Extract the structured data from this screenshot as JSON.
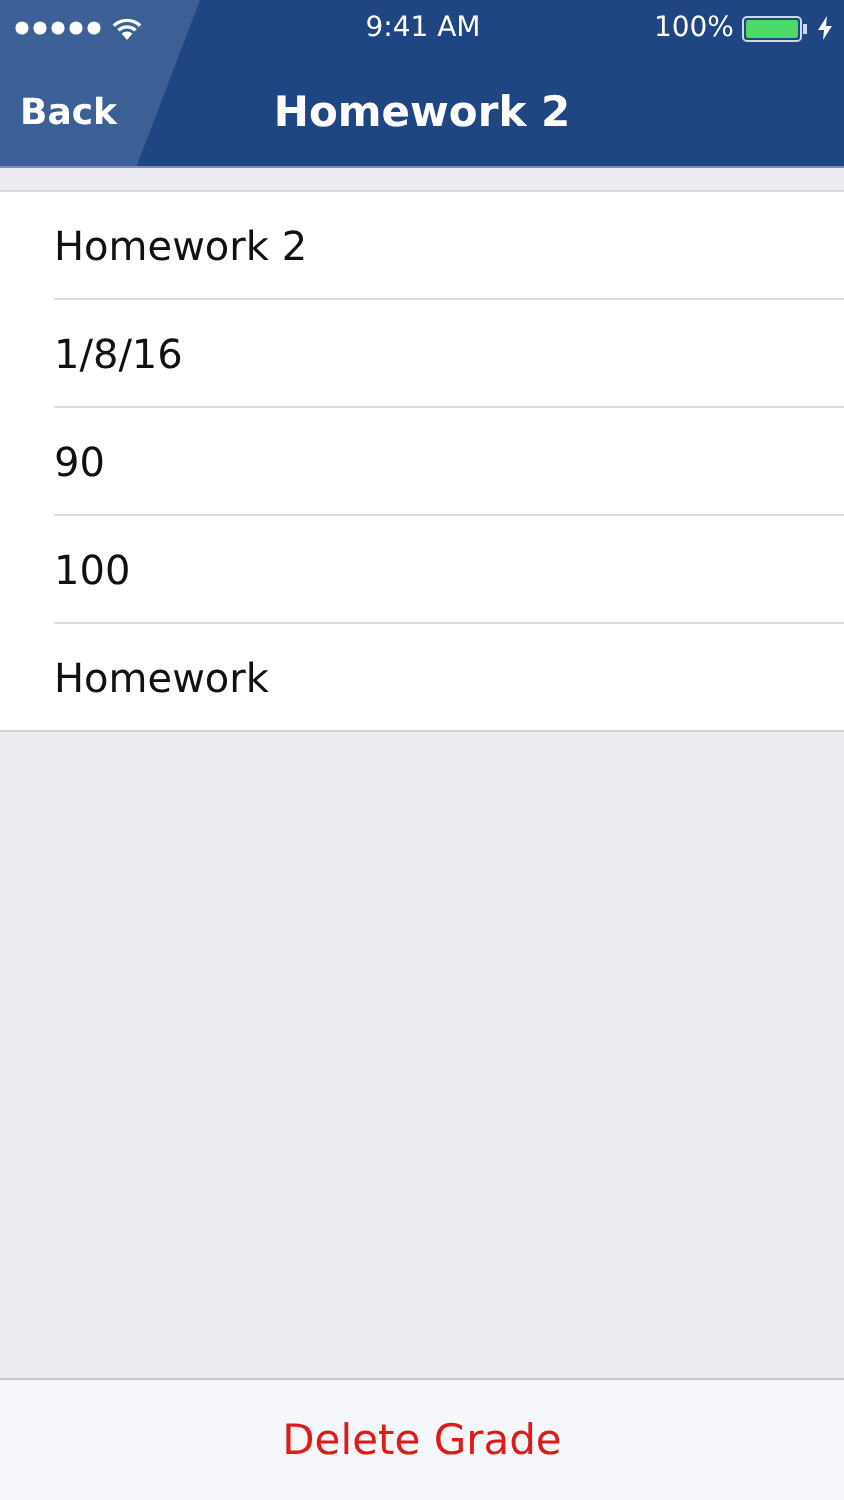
{
  "status_bar": {
    "time": "9:41 AM",
    "battery": "100%"
  },
  "nav_bar": {
    "back": "Back",
    "title": "Homework 2"
  },
  "fields": [
    {
      "value": "Homework 2"
    },
    {
      "value": "1/8/16"
    },
    {
      "value": "90"
    },
    {
      "value": "100"
    },
    {
      "value": "Homework"
    }
  ],
  "footer": {
    "button": "Delete Grade"
  }
}
